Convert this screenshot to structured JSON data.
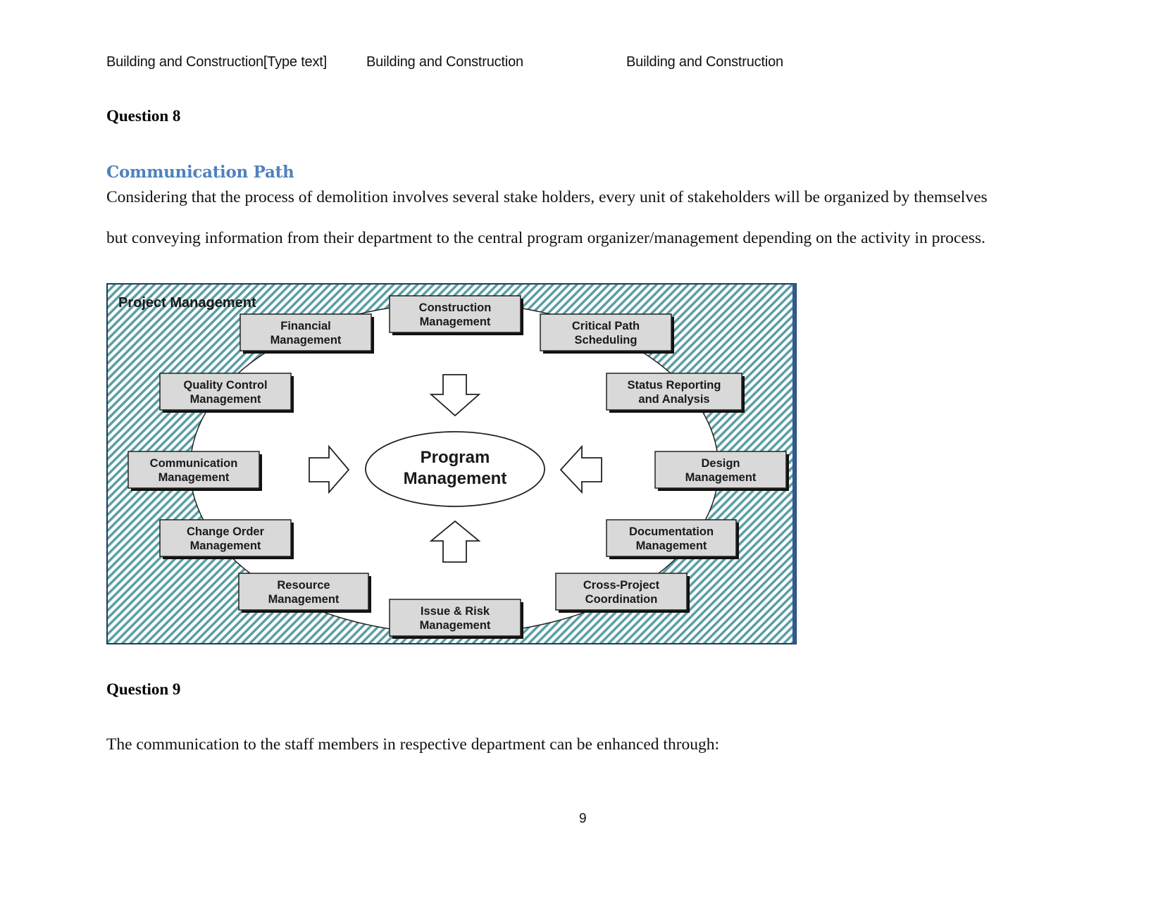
{
  "header": {
    "left": "Building and Construction[Type text]",
    "center": "Building and Construction",
    "right": "Building and Construction"
  },
  "question8": {
    "title": "Question 8",
    "section_heading": "Communication Path",
    "paragraph_lines": [
      "Considering that the process of demolition involves several stake holders, every unit of stakeholders will be organized by themselves",
      "but conveying information from their department to the central program organizer/management depending on the activity in process."
    ]
  },
  "diagram": {
    "frame_title": "Project Management",
    "center_label": [
      "Program",
      "Management"
    ],
    "colors": {
      "hatch": "#5a9ea3",
      "box_fill": "#d9d9d9",
      "frame_border": "#1f3a5f"
    },
    "nodes": [
      {
        "id": "construction",
        "lines": [
          "Construction",
          "Management"
        ]
      },
      {
        "id": "financial",
        "lines": [
          "Financial",
          "Management"
        ]
      },
      {
        "id": "critical-path",
        "lines": [
          "Critical Path",
          "Scheduling"
        ]
      },
      {
        "id": "quality-control",
        "lines": [
          "Quality Control",
          "Management"
        ]
      },
      {
        "id": "status-reporting",
        "lines": [
          "Status Reporting",
          "and Analysis"
        ]
      },
      {
        "id": "communication",
        "lines": [
          "Communication",
          "Management"
        ]
      },
      {
        "id": "design",
        "lines": [
          "Design",
          "Management"
        ]
      },
      {
        "id": "change-order",
        "lines": [
          "Change Order",
          "Management"
        ]
      },
      {
        "id": "documentation",
        "lines": [
          "Documentation",
          "Management"
        ]
      },
      {
        "id": "resource",
        "lines": [
          "Resource",
          "Management"
        ]
      },
      {
        "id": "cross-project",
        "lines": [
          "Cross-Project",
          "Coordination"
        ]
      },
      {
        "id": "issue-risk",
        "lines": [
          "Issue & Risk",
          "Management"
        ]
      }
    ]
  },
  "question9": {
    "title": "Question 9",
    "body": "The communication to the staff members in respective department can be enhanced through:"
  },
  "footer": {
    "page_number": "9"
  }
}
